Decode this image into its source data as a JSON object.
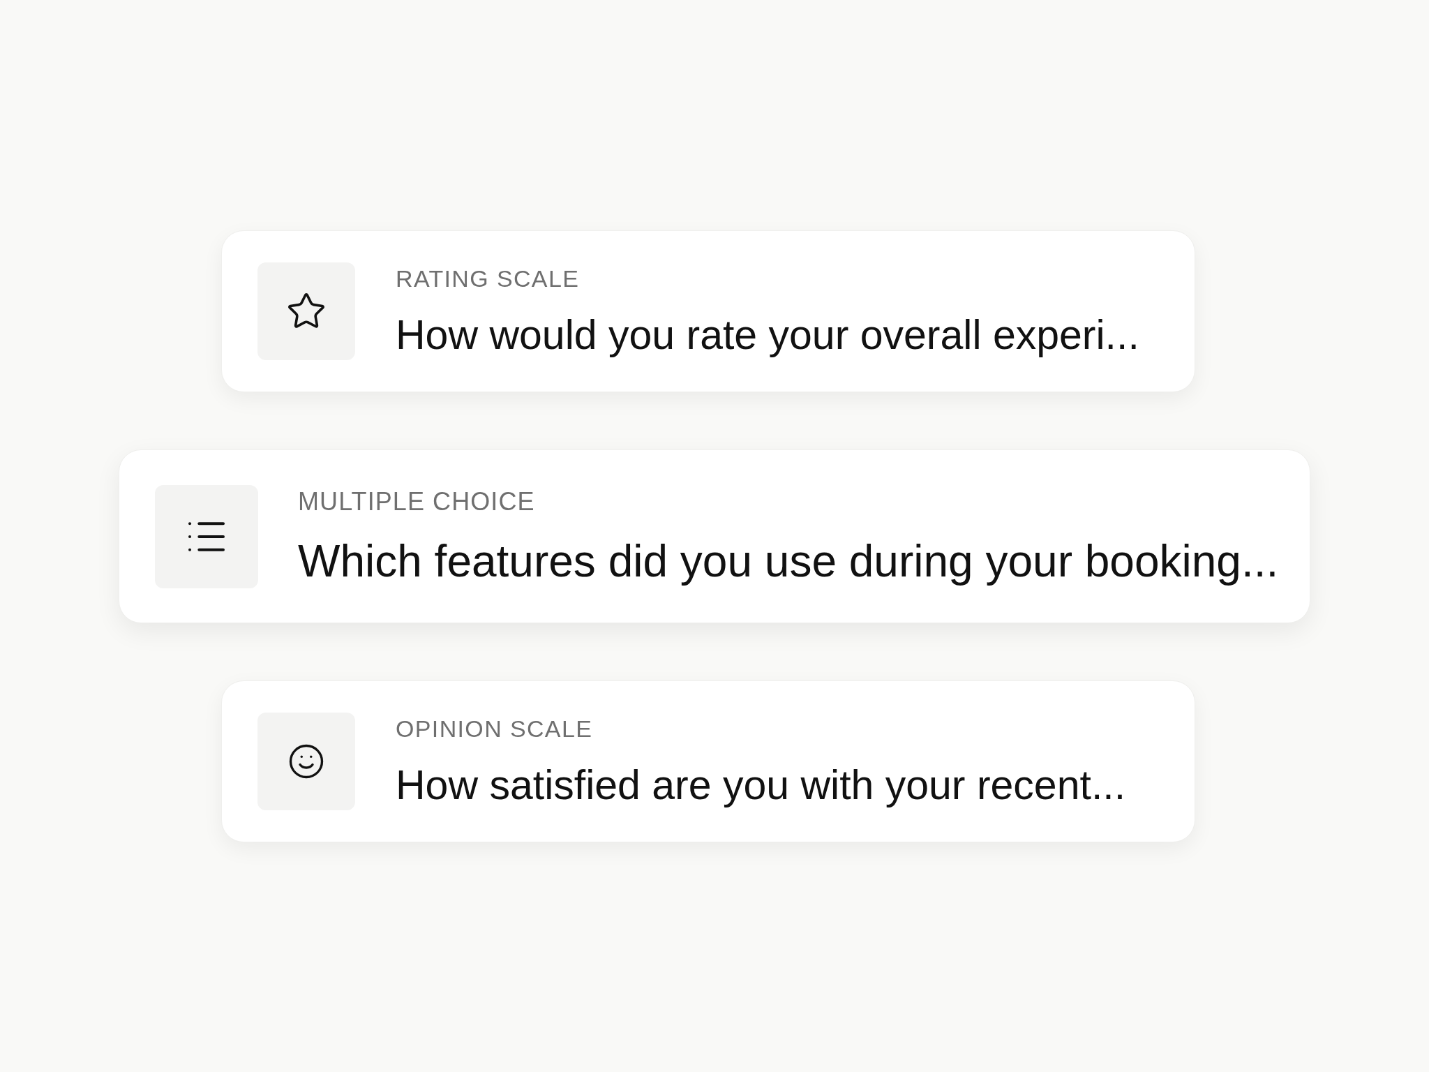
{
  "questions": [
    {
      "kind": "rating",
      "featured": false,
      "type_label": "RATING SCALE",
      "question": "How would you rate your overall experi..."
    },
    {
      "kind": "choice",
      "featured": true,
      "type_label": "MULTIPLE CHOICE",
      "question": "Which features did you use during your booking..."
    },
    {
      "kind": "opinion",
      "featured": false,
      "type_label": "OPINION SCALE",
      "question": "How satisfied are you with your recent..."
    }
  ]
}
